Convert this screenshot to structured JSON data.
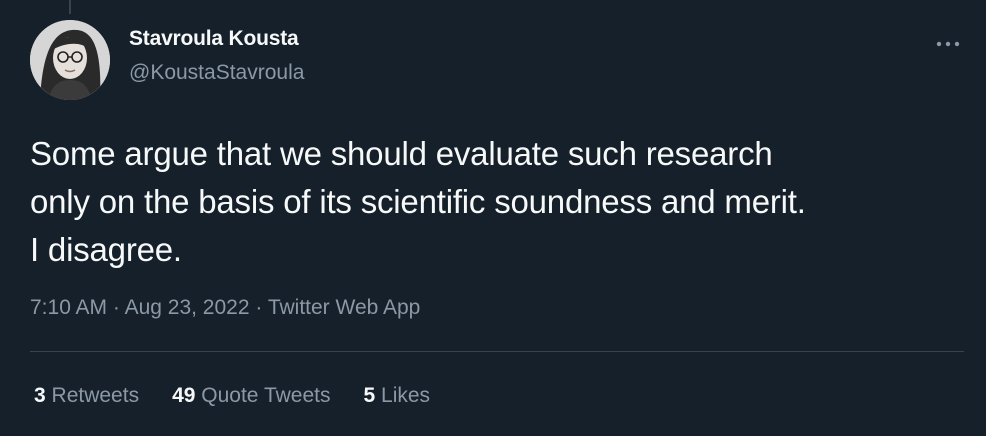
{
  "tweet": {
    "author": {
      "display_name": "Stavroula Kousta",
      "handle": "@KoustaStavroula",
      "avatar_icon": "user-avatar-photo"
    },
    "text": "Some argue that we should evaluate such research\nonly on the basis of its scientific soundness and merit.\nI disagree.",
    "time": "7:10 AM",
    "separator": " · ",
    "date": "Aug 23, 2022",
    "source": "Twitter Web App",
    "stats": {
      "retweets": {
        "count": "3",
        "label": "Retweets"
      },
      "quote_tweets": {
        "count": "49",
        "label": "Quote Tweets"
      },
      "likes": {
        "count": "5",
        "label": "Likes"
      }
    },
    "more_icon": "more-horizontal-icon"
  },
  "colors": {
    "background": "#15202b",
    "text_primary": "#f7f9f9",
    "text_secondary": "#8b98a5",
    "divider": "#38444d"
  }
}
